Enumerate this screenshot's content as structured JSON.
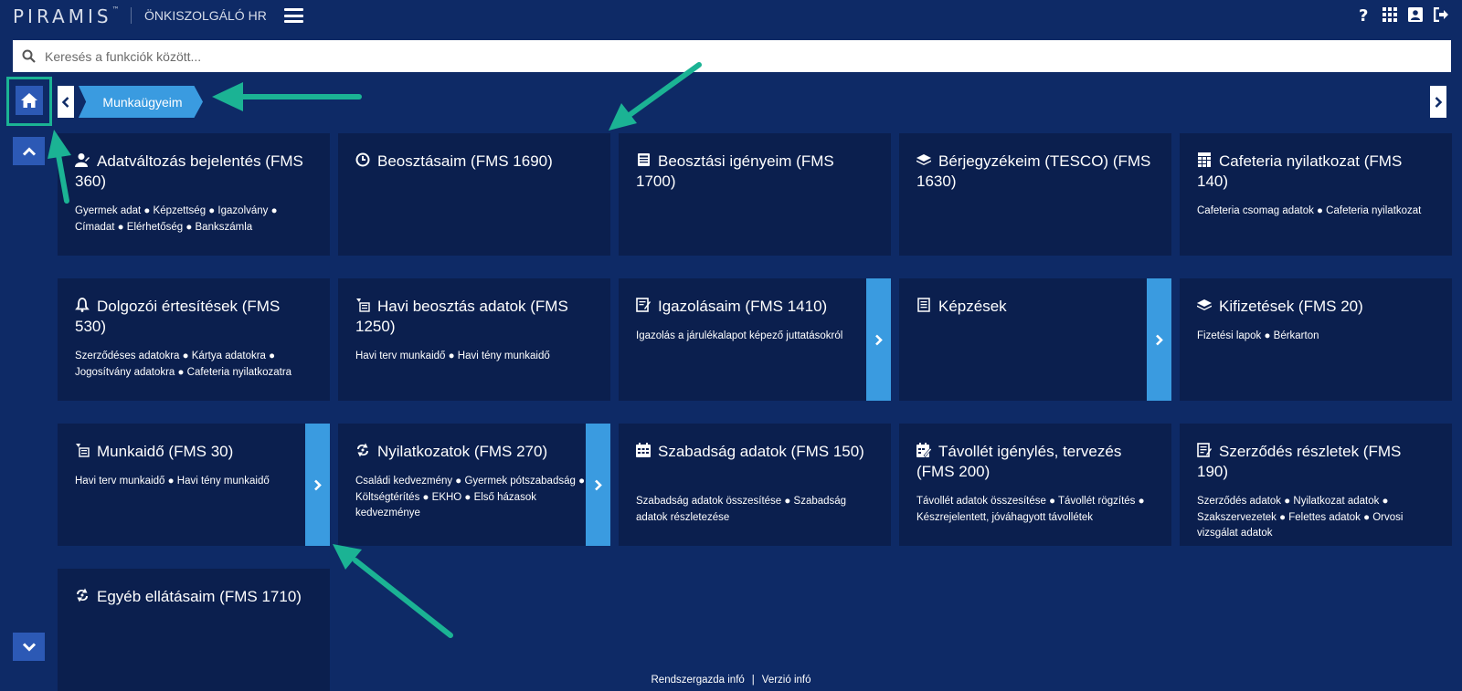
{
  "header": {
    "logo_text": "PIRAMIS",
    "logo_tm": "™",
    "app_title": "ÖNKISZOLGÁLÓ HR",
    "icons": [
      "help-icon",
      "apps-grid-icon",
      "profile-icon",
      "logout-icon"
    ]
  },
  "search": {
    "placeholder": "Keresés a funkciók között...",
    "value": ""
  },
  "breadcrumb": {
    "current": "Munkaügyeim"
  },
  "tiles": [
    {
      "title": "Adatváltozás bejelentés (FMS 360)",
      "icon": "user-icon",
      "subtitle": "Gyermek adat ● Képzettség ● Igazolvány ● Címadat ● Elérhetőség ● Bankszámla",
      "has_arrow": false
    },
    {
      "title": "Beosztásaim (FMS 1690)",
      "icon": "schedule-clock-icon",
      "subtitle": "",
      "has_arrow": false
    },
    {
      "title": "Beosztási igényeim (FMS 1700)",
      "icon": "newspaper-icon",
      "subtitle": "",
      "has_arrow": false
    },
    {
      "title": "Bérjegyzékeim (TESCO) (FMS 1630)",
      "icon": "money-stack-icon",
      "subtitle": "",
      "has_arrow": false
    },
    {
      "title": "Cafeteria nyilatkozat (FMS 140)",
      "icon": "calculator-icon",
      "subtitle": "Cafeteria csomag adatok ● Cafeteria nyilatkozat",
      "has_arrow": false
    },
    {
      "title": "Dolgozói értesítések (FMS 530)",
      "icon": "bell-icon",
      "subtitle": "Szerződéses adatokra ● Kártya adatokra ● Jogosítvány adatokra ● Cafeteria nyilatkozatra",
      "has_arrow": false
    },
    {
      "title": "Havi beosztás adatok (FMS 1250)",
      "icon": "timesheet-icon",
      "subtitle": "Havi terv munkaidő ● Havi tény munkaidő",
      "has_arrow": false
    },
    {
      "title": "Igazolásaim (FMS 1410)",
      "icon": "edit-document-icon",
      "subtitle": "Igazolás a járulékalapot képező juttatásokról",
      "has_arrow": true
    },
    {
      "title": "Képzések",
      "icon": "list-document-icon",
      "subtitle": "",
      "has_arrow": true
    },
    {
      "title": "Kifizetések (FMS 20)",
      "icon": "money-stack-icon",
      "subtitle": "Fizetési lapok ● Bérkarton",
      "has_arrow": false
    },
    {
      "title": "Munkaidő (FMS 30)",
      "icon": "timesheet-icon",
      "subtitle": "Havi terv munkaidő ● Havi tény munkaidő",
      "has_arrow": true
    },
    {
      "title": "Nyilatkozatok (FMS 270)",
      "icon": "cycle-icon",
      "subtitle": "Családi kedvezmény ● Gyermek pótszabadság ● Költségtérítés ● EKHO ● Első házasok kedvezménye",
      "has_arrow": true
    },
    {
      "title": "Szabadság adatok (FMS 150)",
      "icon": "calendar-icon",
      "subtitle": "Szabadság adatok összesítése ● Szabadság adatok részletezése",
      "has_arrow": false
    },
    {
      "title": "Távollét igénylés, tervezés (FMS 200)",
      "icon": "calendar-edit-icon",
      "subtitle": "Távollét adatok összesítése ● Távollét rögzítés ● Készrejelentett, jóváhagyott távollétek",
      "has_arrow": false
    },
    {
      "title": "Szerződés részletek (FMS 190)",
      "icon": "contract-icon",
      "subtitle": "Szerződés adatok ● Nyilatkozat adatok ● Szakszervezetek ● Felettes adatok ● Orvosi vizsgálat adatok",
      "has_arrow": false
    },
    {
      "title": "Egyéb ellátásaim (FMS 1710)",
      "icon": "cycle-icon",
      "subtitle": "",
      "has_arrow": false
    }
  ],
  "footer": {
    "admin_info": "Rendszergazda infó",
    "separator": "|",
    "version_info": "Verzió infó"
  },
  "colors": {
    "background": "#0e2a66",
    "tile": "#0b1f4e",
    "accent": "#3a9be0",
    "button": "#2c59b5",
    "annotation": "#1bb394"
  }
}
